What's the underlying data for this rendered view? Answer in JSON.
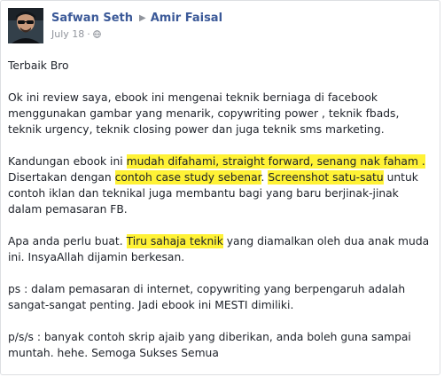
{
  "post": {
    "author": "Safwan Seth",
    "target": "Amir Faisal",
    "date": "July 18",
    "separator": "·",
    "paragraphs": [
      {
        "segments": [
          {
            "text": "Terbaik Bro"
          }
        ]
      },
      {
        "segments": [
          {
            "text": "Ok ini review saya, ebook ini mengenai teknik berniaga di facebook menggunakan gambar yang menarik, copywriting power , teknik fbads, teknik urgency, teknik closing power dan juga teknik sms marketing."
          }
        ]
      },
      {
        "segments": [
          {
            "text": "Kandungan ebook ini "
          },
          {
            "text": "mudah difahami, straight forward, senang nak faham .",
            "highlight": true
          },
          {
            "text": " Disertakan dengan "
          },
          {
            "text": "contoh case study sebenar",
            "highlight": true
          },
          {
            "text": ". "
          },
          {
            "text": "Screenshot satu-satu",
            "highlight": true
          },
          {
            "text": " untuk contoh iklan dan teknikal juga membantu bagi yang baru berjinak-jinak dalam pemasaran FB."
          }
        ]
      },
      {
        "segments": [
          {
            "text": "Apa anda perlu buat. "
          },
          {
            "text": "Tiru sahaja teknik",
            "highlight": true
          },
          {
            "text": " yang diamalkan oleh dua anak muda ini. InsyaAllah dijamin berkesan."
          }
        ]
      },
      {
        "segments": [
          {
            "text": "ps : dalam pemasaran di internet, copywriting yang berpengaruh adalah sangat-sangat penting. Jadi ebook ini MESTI dimiliki."
          }
        ]
      },
      {
        "segments": [
          {
            "text": "p/s/s : banyak contoh skrip ajaib yang diberikan, anda boleh guna sampai muntah. hehe. Semoga Sukses Semua"
          }
        ]
      }
    ]
  },
  "icons": {
    "arrow": "right-triangle-icon",
    "audience": "globe-icon"
  },
  "colors": {
    "link": "#3b5998",
    "meta": "#90949c",
    "highlight": "#fff236",
    "text": "#1d2129"
  }
}
